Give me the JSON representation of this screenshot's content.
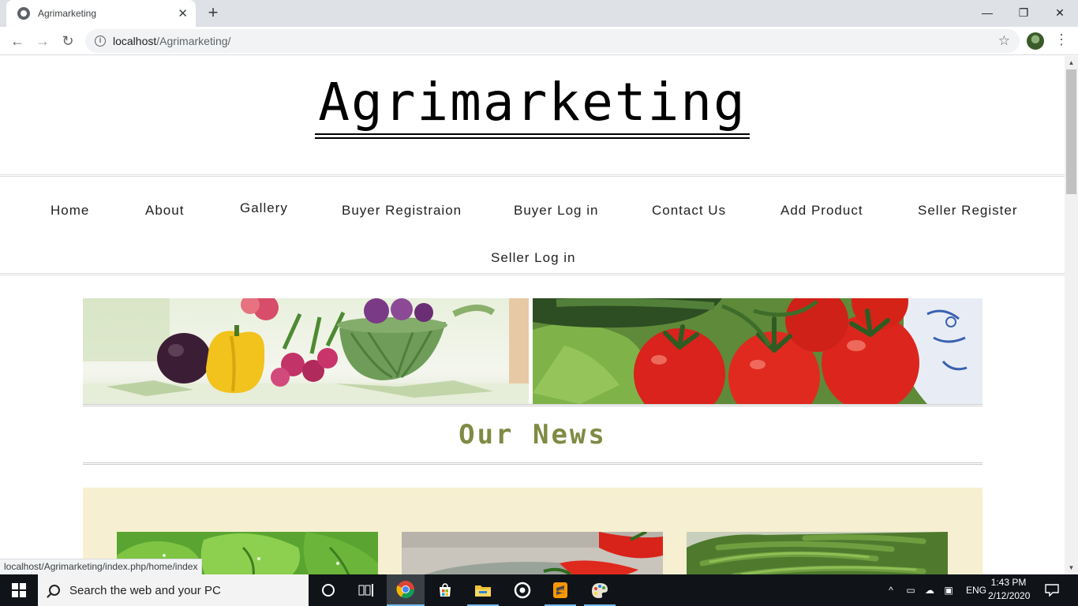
{
  "browser": {
    "tab_title": "Agrimarketing",
    "url_host": "localhost",
    "url_path": "/Agrimarketing/",
    "status_url": "localhost/Agrimarketing/index.php/home/index"
  },
  "site": {
    "brand": "Agrimarketing",
    "nav": [
      "Home",
      "About",
      "Gallery",
      "Buyer Registraion",
      "Buyer Log in",
      "Contact Us",
      "Add Product",
      "Seller Register",
      "Seller Log in"
    ],
    "news_heading": "Our News",
    "colors": {
      "accent": "#7f8a43",
      "news_bg": "#f7efd1"
    }
  },
  "taskbar": {
    "search_placeholder": "Search the web and your PC",
    "language": "ENG",
    "time": "1:43 PM",
    "date": "2/12/2020",
    "apps": [
      "cortana-icon",
      "task-view-icon",
      "chrome-icon",
      "store-icon",
      "file-explorer-icon",
      "media-icon",
      "sublime-icon",
      "paint-icon"
    ]
  }
}
